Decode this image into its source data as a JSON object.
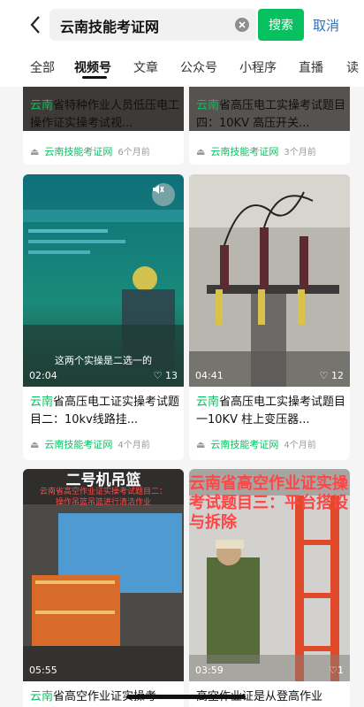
{
  "search": {
    "query": "云南技能考证网",
    "button": "搜索",
    "cancel": "取消"
  },
  "tabs": [
    "全部",
    "视频号",
    "文章",
    "公众号",
    "小程序",
    "直播",
    "读"
  ],
  "active_tab": "视频号",
  "cards": [
    {
      "title_hl": "云南",
      "title_rest": "省特种作业人员低压电工操作证实操考试视...",
      "author": "云南技能考证网",
      "ago": "6个月前"
    },
    {
      "title_hl": "云南",
      "title_rest": "省高压电工实操考试题目四：10KV 高压开关...",
      "author": "云南技能考证网",
      "ago": "3个月前"
    },
    {
      "duration": "02:04",
      "likes": "♡ 13",
      "subtitle": "这两个实操是二选一的",
      "title_hl": "云南",
      "title_rest": "省高压电工证实操考试题目二：10kv线路挂...",
      "author": "云南技能考证网",
      "ago": "4个月前"
    },
    {
      "duration": "04:41",
      "likes": "♡ 12",
      "title_hl": "云南",
      "title_rest": "省高压电工实操考试题目一10KV 柱上变压器...",
      "author": "云南技能考证网",
      "ago": "4个月前"
    },
    {
      "duration": "05:55",
      "overlay_title": "二号机吊篮",
      "overlay_text": "云南省高空作业证实操考试题目二：操作吊篮吊篮进行清洁作业",
      "title_hl": "云南",
      "title_rest": "省高空作业证实操考"
    },
    {
      "duration": "03:59",
      "likes": "♡1",
      "overlay_text": "云南省高空作业证实操考试题目三：平台搭设与拆除",
      "title_hl": "",
      "title_rest": "高空作业证是从登高作业"
    }
  ]
}
